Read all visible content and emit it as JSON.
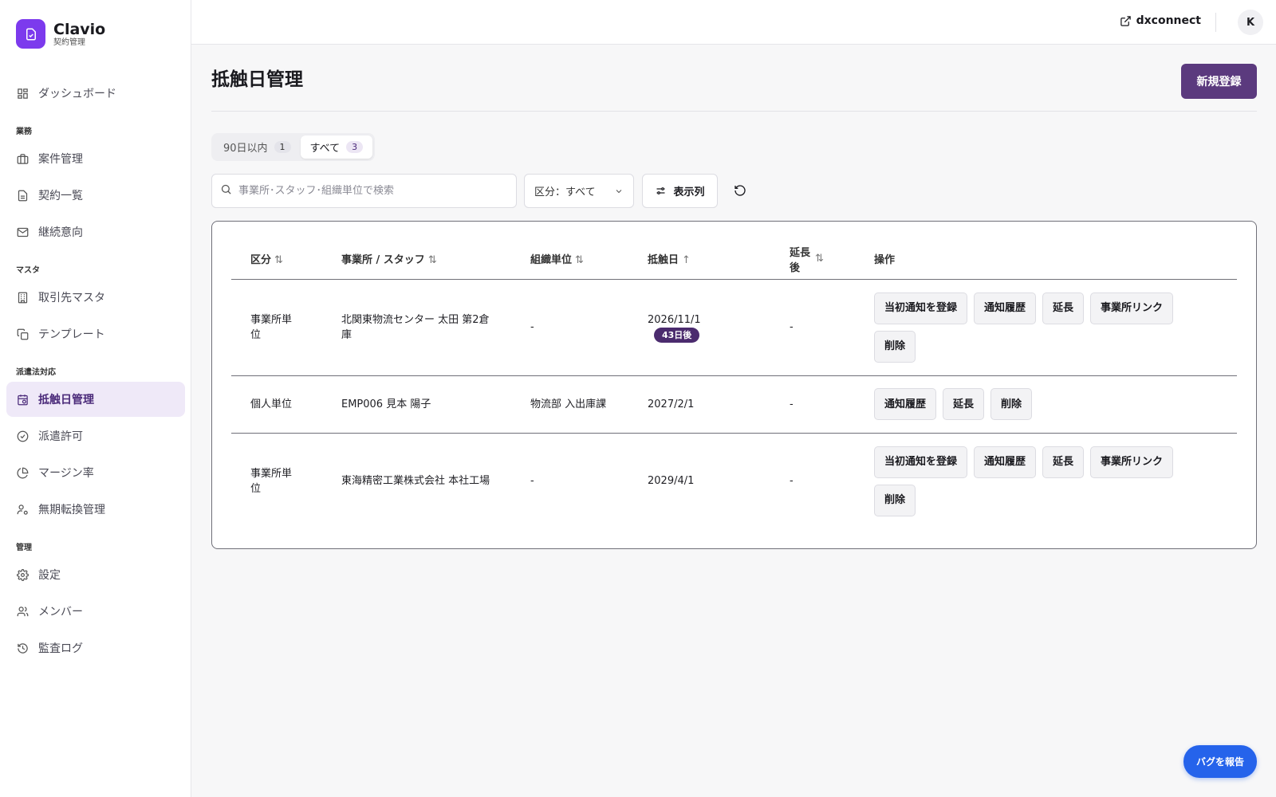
{
  "brand": {
    "name": "Clavio",
    "subtitle": "契約管理"
  },
  "sidebar": {
    "top_items": [
      {
        "label": "ダッシュボード",
        "icon": "dashboard-icon"
      }
    ],
    "sections": [
      {
        "title": "業務",
        "items": [
          {
            "label": "案件管理",
            "icon": "briefcase-icon"
          },
          {
            "label": "契約一覧",
            "icon": "document-icon"
          },
          {
            "label": "継続意向",
            "icon": "mail-icon"
          }
        ]
      },
      {
        "title": "マスタ",
        "items": [
          {
            "label": "取引先マスタ",
            "icon": "building-icon"
          },
          {
            "label": "テンプレート",
            "icon": "copy-icon"
          }
        ]
      },
      {
        "title": "派遣法対応",
        "items": [
          {
            "label": "抵触日管理",
            "icon": "calendar-clock-icon",
            "active": true
          },
          {
            "label": "派遣許可",
            "icon": "check-circle-icon"
          },
          {
            "label": "マージン率",
            "icon": "pie-chart-icon"
          },
          {
            "label": "無期転換管理",
            "icon": "user-cog-icon"
          }
        ]
      },
      {
        "title": "管理",
        "items": [
          {
            "label": "設定",
            "icon": "gear-icon"
          },
          {
            "label": "メンバー",
            "icon": "users-icon"
          },
          {
            "label": "監査ログ",
            "icon": "history-icon"
          }
        ]
      }
    ]
  },
  "topbar": {
    "external_link_label": "dxconnect",
    "avatar_initial": "K"
  },
  "page": {
    "title": "抵触日管理",
    "new_button_label": "新規登録",
    "tabs": [
      {
        "label": "90日以内",
        "count": "1",
        "active": false
      },
      {
        "label": "すべて",
        "count": "3",
        "active": true
      }
    ],
    "search_placeholder": "事業所･スタッフ･組織単位で検索",
    "filter_select_label": "区分：すべて",
    "columns_button_label": "表示列",
    "report_bug_label": "バグを報告"
  },
  "table": {
    "headers": [
      {
        "label": "区分",
        "sort": "⇅"
      },
      {
        "label": "事業所 / スタッフ",
        "sort": "⇅"
      },
      {
        "label": "組織単位",
        "sort": "⇅"
      },
      {
        "label": "抵触日",
        "sort": "↑"
      },
      {
        "label": "延長後",
        "sort": "⇅"
      },
      {
        "label": "操作",
        "sort": ""
      }
    ],
    "rows": [
      {
        "category": "事業所単位",
        "office_staff": "北関東物流センター 太田 第2倉庫",
        "org_unit": "-",
        "conflict_date": "2026/11/1",
        "days_badge": "43日後",
        "extended": "-",
        "actions": [
          "当初通知を登録",
          "通知履歴",
          "延長",
          "事業所リンク",
          "削除"
        ]
      },
      {
        "category": "個人単位",
        "office_staff": "EMP006 見本 陽子",
        "org_unit": "物流部 入出庫課",
        "conflict_date": "2027/2/1",
        "days_badge": "",
        "extended": "-",
        "actions": [
          "通知履歴",
          "延長",
          "削除"
        ]
      },
      {
        "category": "事業所単位",
        "office_staff": "東海精密工業株式会社 本社工場",
        "org_unit": "-",
        "conflict_date": "2029/4/1",
        "days_badge": "",
        "extended": "-",
        "actions": [
          "当初通知を登録",
          "通知履歴",
          "延長",
          "事業所リンク",
          "削除"
        ]
      }
    ]
  },
  "colors": {
    "accent": "#7c3aed",
    "primary_button": "#5b3a7e",
    "active_nav_bg": "#efe9f8",
    "badge": "#4b2b6e",
    "bug_button": "#2563eb"
  }
}
